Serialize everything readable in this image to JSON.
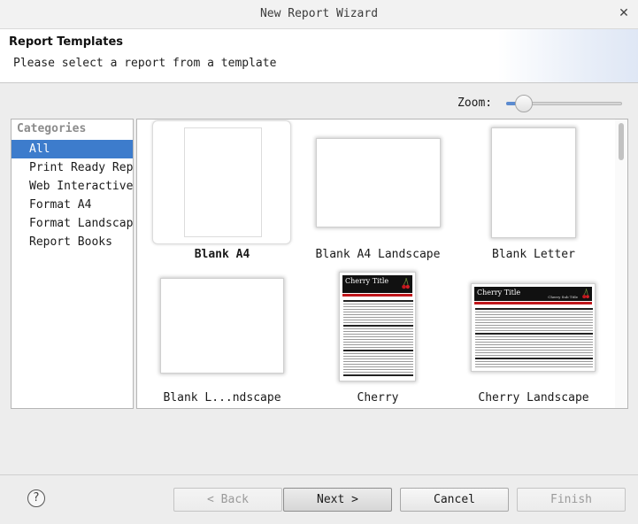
{
  "window": {
    "title": "New Report Wizard",
    "close_icon": "close-icon"
  },
  "header": {
    "heading": "Report Templates",
    "description": "Please select a report from a template"
  },
  "zoom": {
    "label": "Zoom:",
    "level": 0.05
  },
  "categories": {
    "header": "Categories",
    "items": [
      {
        "label": "All",
        "selected": true
      },
      {
        "label": "Print Ready Reports",
        "selected": false
      },
      {
        "label": "Web Interactive",
        "selected": false
      },
      {
        "label": "Format A4",
        "selected": false
      },
      {
        "label": "Format Landscape",
        "selected": false
      },
      {
        "label": "Report Books",
        "selected": false
      }
    ]
  },
  "templates": [
    {
      "label": "Blank A4",
      "selected": true
    },
    {
      "label": "Blank A4 Landscape",
      "selected": false
    },
    {
      "label": "Blank Letter",
      "selected": false
    },
    {
      "label": "Blank L...ndscape",
      "selected": false
    },
    {
      "label": "Cherry",
      "selected": false
    },
    {
      "label": "Cherry Landscape",
      "selected": false
    }
  ],
  "cherry_thumb": {
    "title": "Cherry Title",
    "subtitle": "Cherry Sub Title"
  },
  "buttons": {
    "help": "?",
    "back": "< Back",
    "next": "Next >",
    "cancel": "Cancel",
    "finish": "Finish"
  },
  "colors": {
    "selection": "#3d7ccc",
    "cherry_red": "#c0171c"
  }
}
